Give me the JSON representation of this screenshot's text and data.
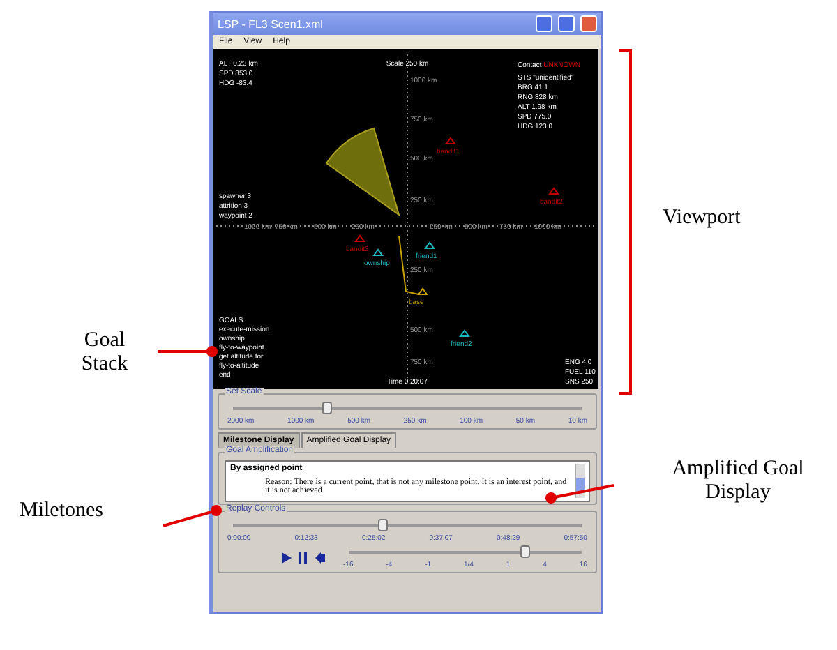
{
  "window": {
    "title": "LSP - FL3 Scen1.xml"
  },
  "menu": [
    "File",
    "View",
    "Help"
  ],
  "viewport": {
    "scale": "Scale 250 km",
    "ownship": [
      "ALT 0.23 km",
      "SPD 853.0",
      "HDG -83.4"
    ],
    "contact_label": "Contact",
    "contact_id": "UNKNOWN",
    "contact_info": [
      "STS \"unidentified\"",
      "BRG 41.1",
      "RNG 828 km",
      "ALT 1.98 km",
      "SPD 775.0",
      "HDG 123.0"
    ],
    "counts": [
      "spawner  3",
      "attrition  3",
      "waypoint  2"
    ],
    "goal_stack": [
      "GOALS",
      "execute-mission",
      "ownship",
      "fly-to-waypoint",
      "get altitude for",
      "fly-to-altitude",
      "end"
    ],
    "time": "Time 0:20:07",
    "engine": [
      "ENG 4.0",
      "FUEL 110",
      "SNS 250"
    ],
    "x_ticks": [
      "1000 km",
      "750 km",
      "500 km",
      "250 km",
      "250 km",
      "500 km",
      "750 km",
      "1000 km"
    ],
    "y_ticks": [
      "1000 km",
      "750 km",
      "500 km",
      "250 km",
      "250 km",
      "500 km",
      "750 km"
    ],
    "tracks": [
      {
        "label": "bandit1",
        "kind": "hostile"
      },
      {
        "label": "bandit2",
        "kind": "hostile"
      },
      {
        "label": "bandit3",
        "kind": "hostile"
      },
      {
        "label": "friend1",
        "kind": "friendly"
      },
      {
        "label": "ownship",
        "kind": "friendly"
      },
      {
        "label": "base",
        "kind": "own"
      },
      {
        "label": "friend2",
        "kind": "friendly"
      }
    ]
  },
  "set_scale": {
    "title": "Set Scale",
    "level": 0.27,
    "ticks": [
      "2000 km",
      "1000 km",
      "500 km",
      "250 km",
      "100 km",
      "50 km",
      "10 km"
    ]
  },
  "tabs": [
    {
      "label": "Milestone Display",
      "selected": true
    },
    {
      "label": "Amplified Goal Display",
      "selected": false
    }
  ],
  "goal_amplification": {
    "title": "Goal Amplification",
    "heading": "By assigned point",
    "text": "Reason: There is a current point, that is not any milestone point. It is an interest point, and it is not achieved"
  },
  "replay": {
    "title": "Replay Controls",
    "level": 0.43,
    "times": [
      "0:00:00",
      "0:12:33",
      "0:25:02",
      "0:37:07",
      "0:48:29",
      "0:57:50"
    ],
    "speed": {
      "level": 0.76,
      "ticks": [
        "-16",
        "-4",
        "-1",
        "1/4",
        "1",
        "4",
        "16"
      ]
    }
  },
  "annotations": [
    {
      "text": "Goal Stack",
      "kind": "goal-stack"
    },
    {
      "text": "Miletones",
      "kind": "milestones"
    },
    {
      "text": "Viewport",
      "kind": "viewport"
    },
    {
      "text": "Amplified Goal Display",
      "kind": "amplified"
    }
  ]
}
